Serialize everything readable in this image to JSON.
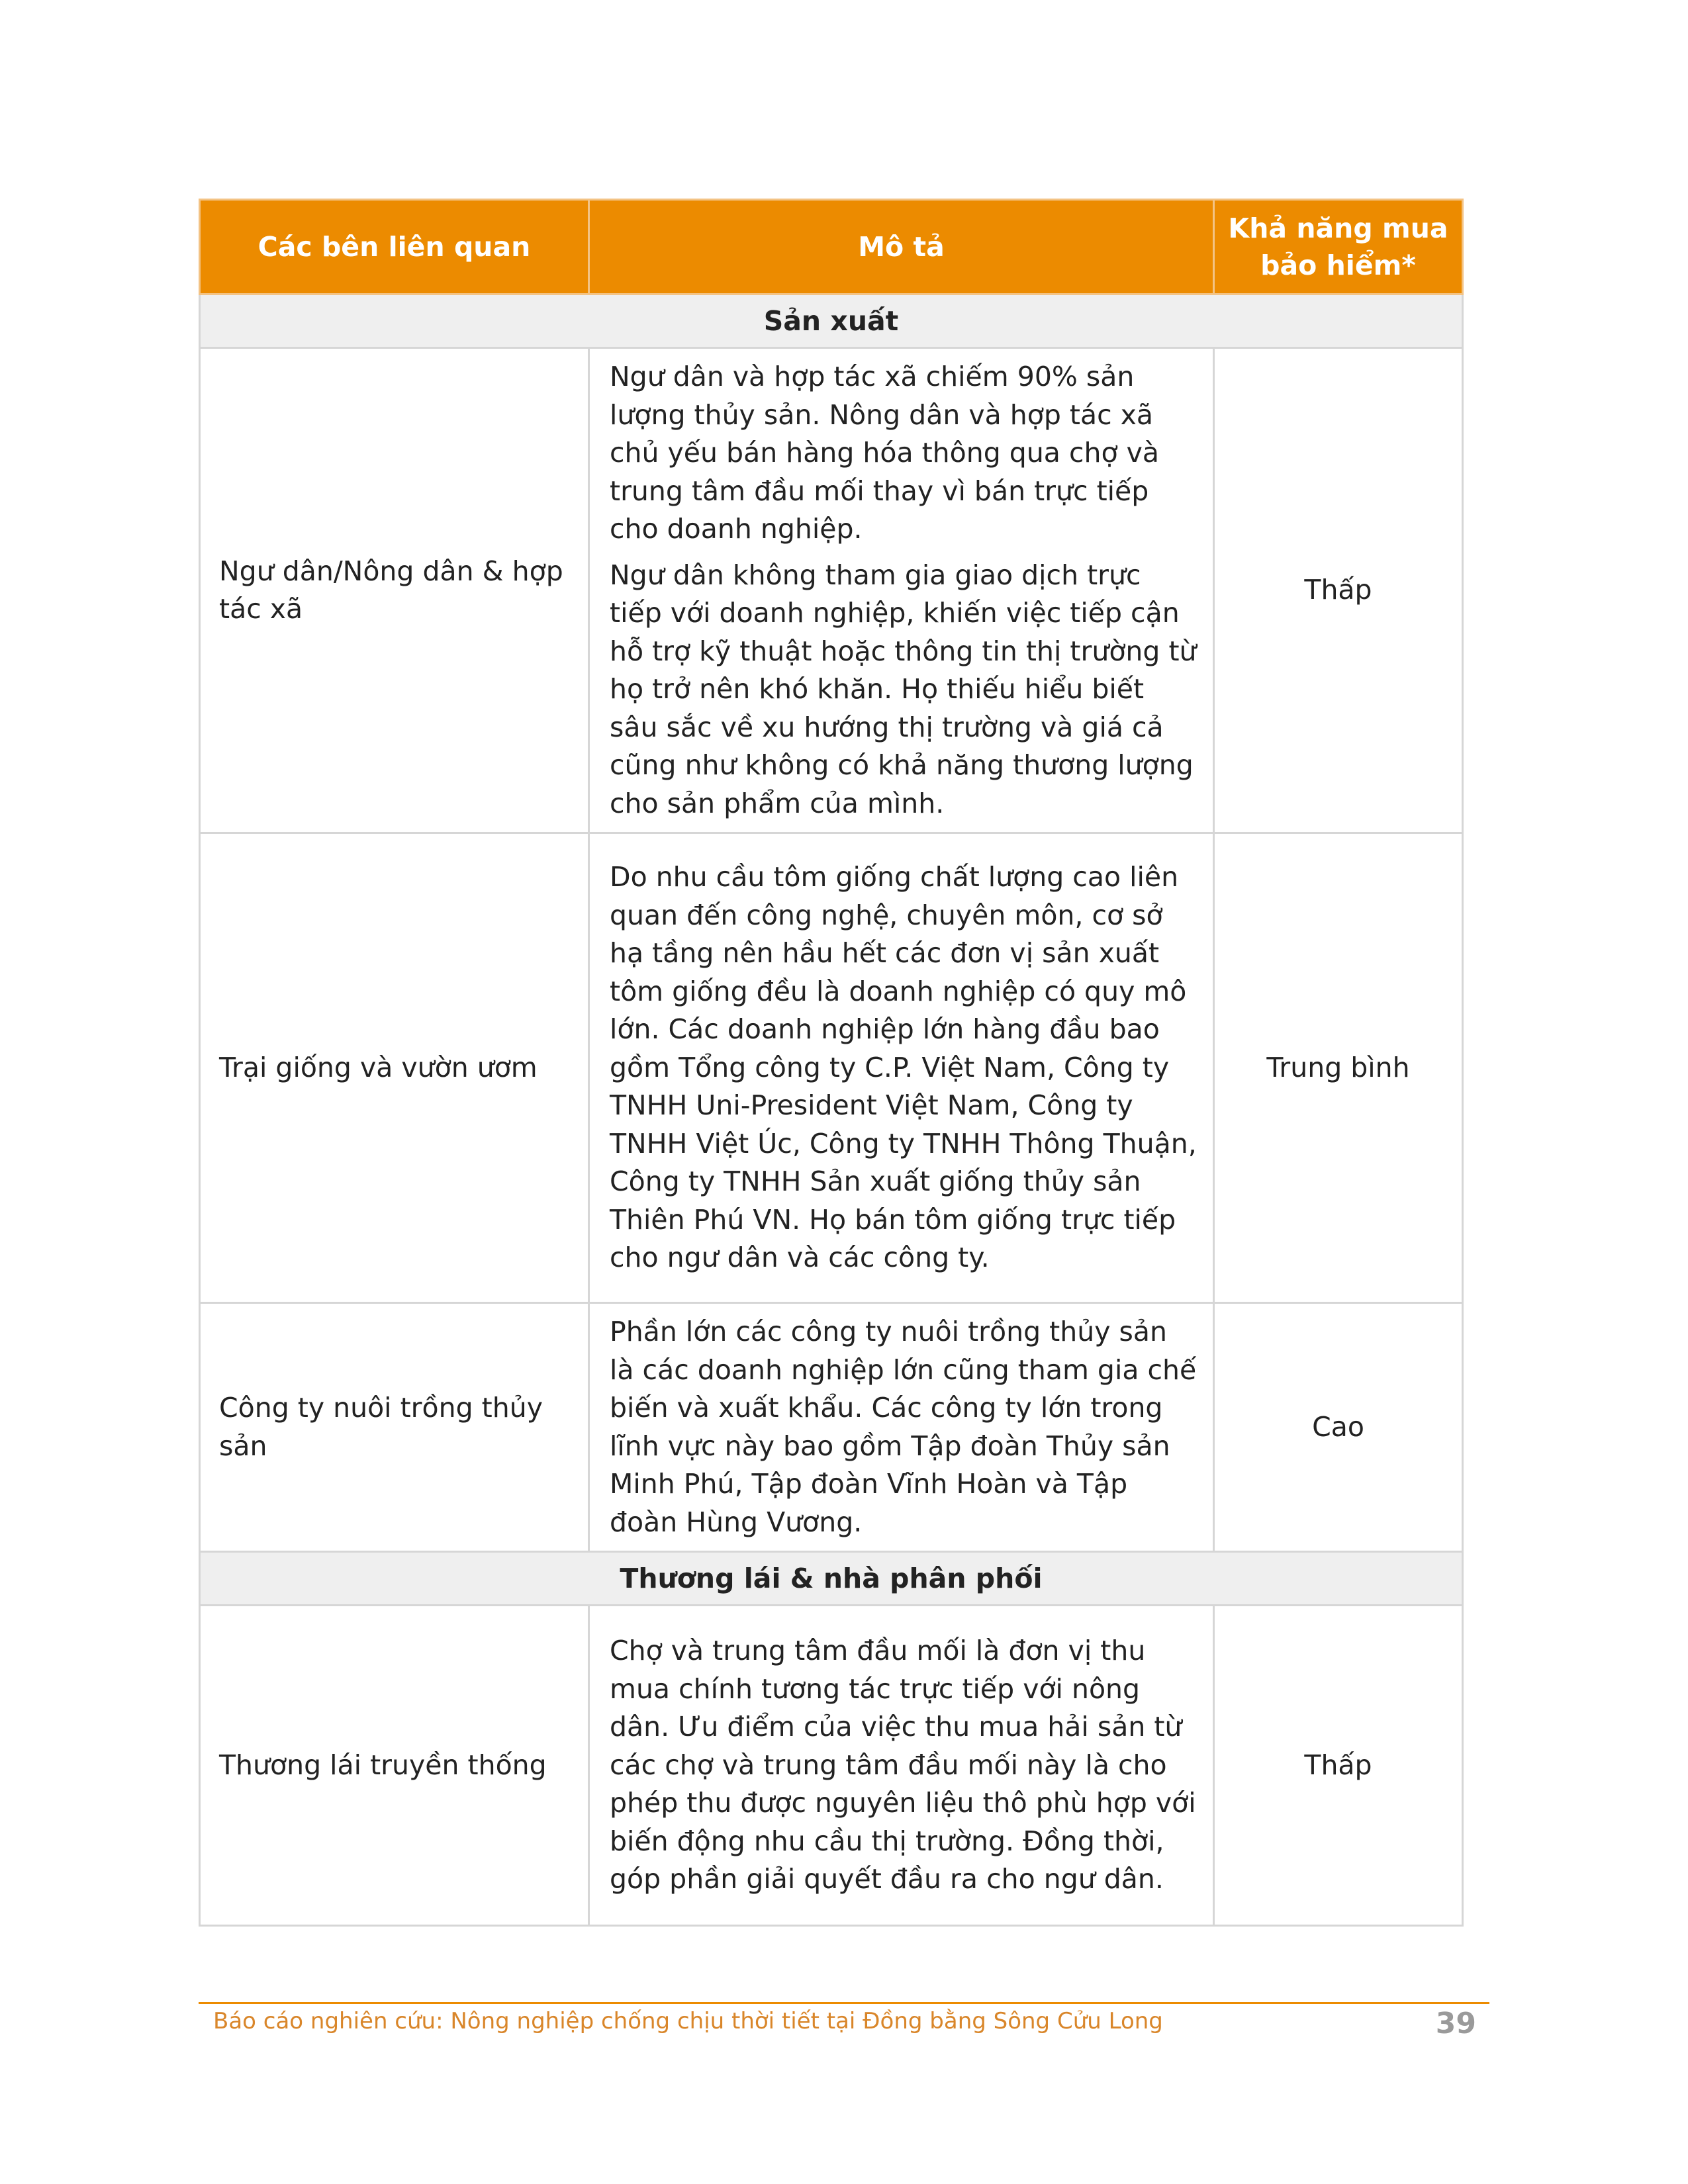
{
  "table": {
    "headers": {
      "stakeholders": "Các bên liên quan",
      "description": "Mô tả",
      "insurance": "Khả năng mua bảo hiểm*"
    },
    "sections": [
      {
        "title": "Sản xuất",
        "rows": [
          {
            "name": "Ngư dân/Nông dân & hợp tác xã",
            "paragraphs": [
              "Ngư dân và hợp tác xã chiếm 90% sản lượng thủy sản. Nông dân và hợp tác xã chủ yếu bán hàng hóa thông qua chợ và trung tâm đầu mối thay vì bán trực tiếp cho doanh nghiệp.",
              "Ngư dân không tham gia giao dịch trực tiếp với doanh nghiệp, khiến việc tiếp cận hỗ trợ kỹ thuật hoặc thông tin thị trường từ họ trở nên khó khăn. Họ thiếu hiểu biết sâu sắc về xu hướng thị trường và giá cả cũng như không có khả năng thương lượng cho sản phẩm của mình."
            ],
            "level": "Thấp"
          },
          {
            "name": "Trại giống và vườn ươm",
            "paragraphs": [
              "Do nhu cầu tôm giống chất lượng cao liên quan đến công nghệ, chuyên môn, cơ sở hạ tầng nên hầu hết các đơn vị sản xuất tôm giống đều là doanh nghiệp có quy mô lớn. Các doanh nghiệp lớn hàng đầu bao gồm Tổng công ty C.P. Việt Nam, Công ty TNHH Uni-President Việt Nam, Công ty TNHH Việt Úc, Công ty TNHH Thông Thuận, Công ty TNHH Sản xuất giống thủy sản Thiên Phú VN. Họ bán tôm giống trực tiếp cho ngư dân và các công ty."
            ],
            "level": "Trung bình"
          },
          {
            "name": "Công ty nuôi trồng thủy sản",
            "paragraphs": [
              "Phần lớn các công ty nuôi trồng thủy sản là các doanh nghiệp lớn cũng tham gia chế biến và xuất khẩu. Các công ty lớn trong lĩnh vực này bao gồm Tập đoàn Thủy sản Minh Phú, Tập đoàn Vĩnh Hoàn và Tập đoàn Hùng Vương."
            ],
            "level": "Cao"
          }
        ]
      },
      {
        "title": "Thương lái & nhà phân phối",
        "rows": [
          {
            "name": "Thương lái truyền thống",
            "paragraphs": [
              "Chợ và trung tâm đầu mối là đơn vị thu mua chính tương tác trực tiếp với nông dân. Ưu điểm của việc thu mua hải sản từ các chợ và trung tâm đầu mối này là cho phép thu được nguyên liệu thô phù hợp với biến động nhu cầu thị trường. Đồng thời, góp phần giải quyết đầu ra cho ngư dân."
            ],
            "level": "Thấp"
          }
        ]
      }
    ]
  },
  "footer": {
    "report_title": "Báo cáo nghiên cứu: Nông nghiệp chống chịu thời tiết tại Đồng bằng Sông Cửu Long",
    "page_number": "39"
  },
  "colors": {
    "accent": "#ec8b00",
    "section_bg": "#efefef",
    "border": "#d6d6d6",
    "page_number": "#9a9a9a"
  }
}
